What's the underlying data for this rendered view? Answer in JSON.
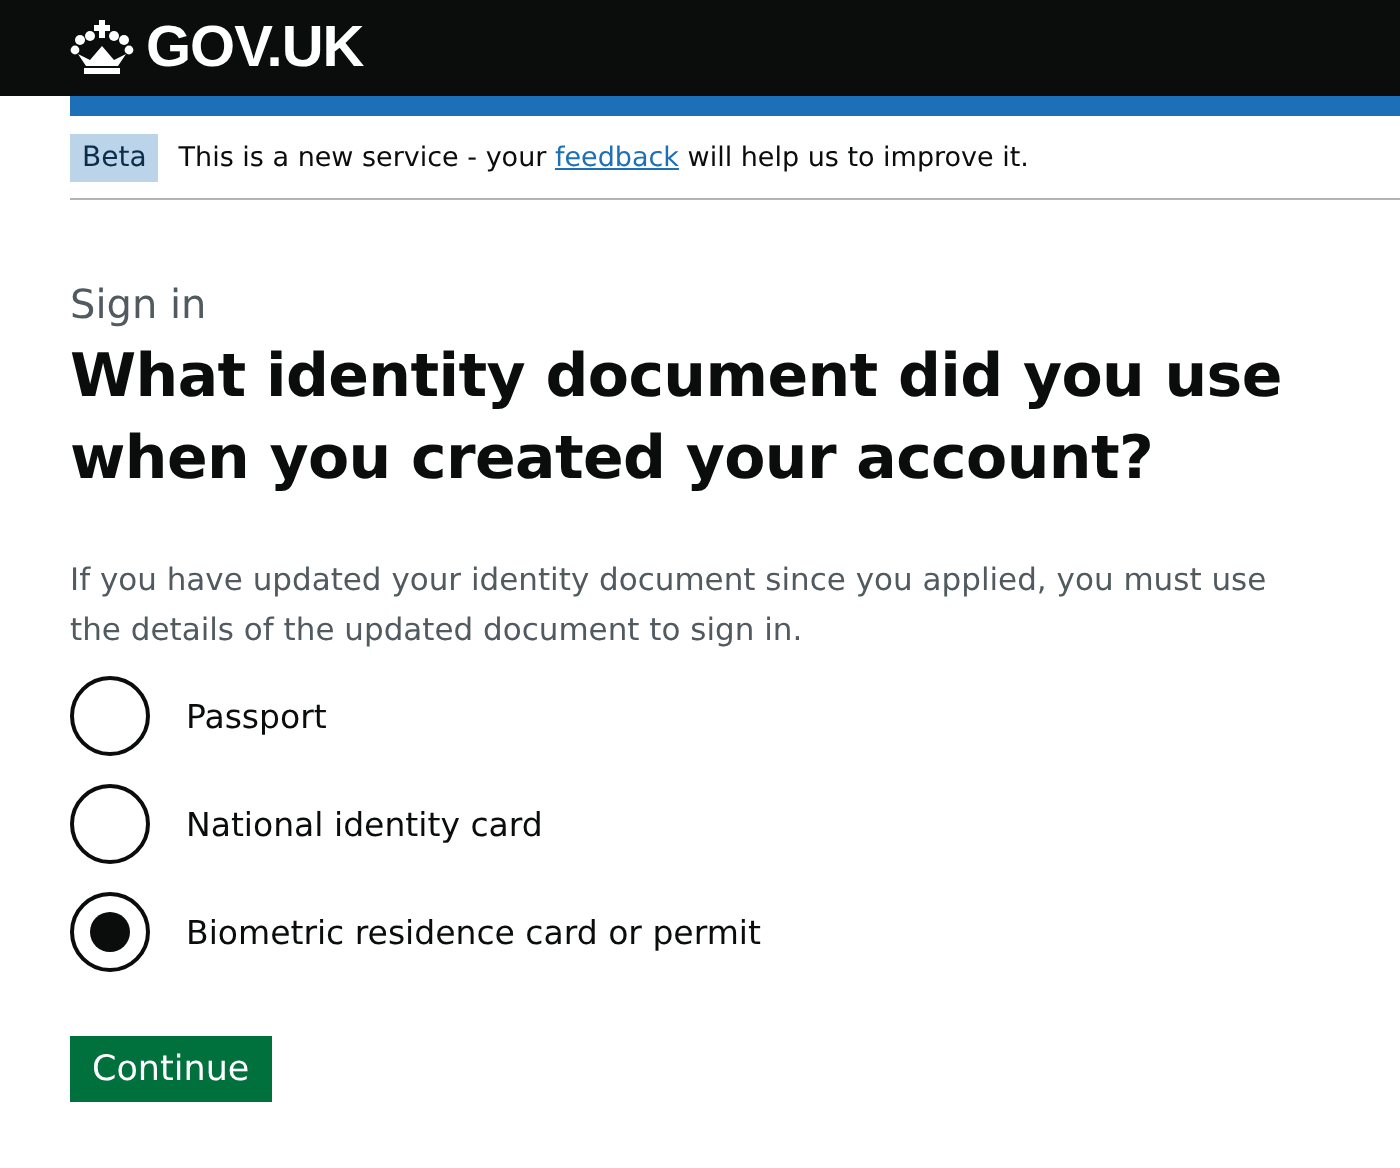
{
  "header": {
    "logo_text": "GOV.UK"
  },
  "phase_banner": {
    "tag": "Beta",
    "text_before": "This is a new service - your ",
    "link": "feedback",
    "text_after": " will help us to improve it."
  },
  "caption": "Sign in",
  "heading": "What identity document did you use when you created your account?",
  "hint": "If you have updated your identity document since you applied, you must use the details of the updated document to sign in.",
  "options": [
    {
      "label": "Passport",
      "selected": false
    },
    {
      "label": "National identity card",
      "selected": false
    },
    {
      "label": "Biometric residence card or permit",
      "selected": true
    }
  ],
  "button": "Continue"
}
